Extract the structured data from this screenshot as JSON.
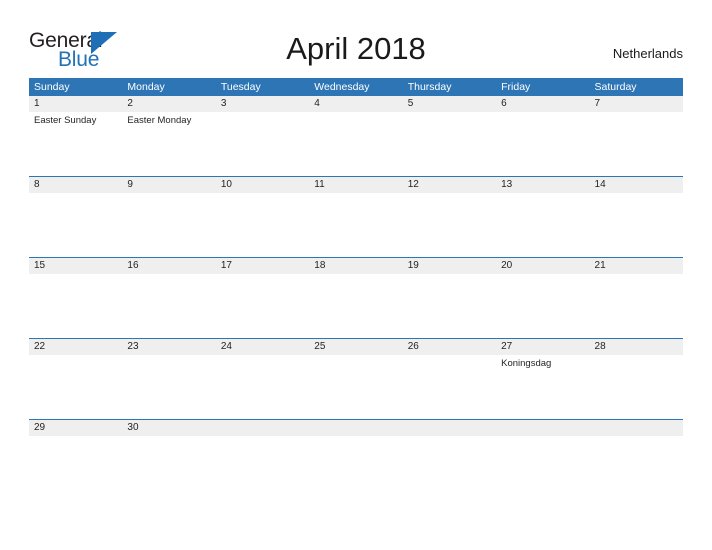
{
  "brand": {
    "line1": "General",
    "line2": "Blue",
    "triangle_color": "#1f6fb6",
    "text_color": "#231f20",
    "accent_color": "#2272b8"
  },
  "header": {
    "title": "April 2018",
    "region": "Netherlands"
  },
  "colors": {
    "header_blue": "#2e75b6",
    "date_band_gray": "#efefef",
    "rule_blue": "#2e75b6",
    "page_background": "#ffffff",
    "text": "#231f20"
  },
  "weekdays": [
    "Sunday",
    "Monday",
    "Tuesday",
    "Wednesday",
    "Thursday",
    "Friday",
    "Saturday"
  ],
  "weeks": [
    {
      "days": [
        {
          "date": "1",
          "event": "Easter Sunday"
        },
        {
          "date": "2",
          "event": "Easter Monday"
        },
        {
          "date": "3",
          "event": ""
        },
        {
          "date": "4",
          "event": ""
        },
        {
          "date": "5",
          "event": ""
        },
        {
          "date": "6",
          "event": ""
        },
        {
          "date": "7",
          "event": ""
        }
      ]
    },
    {
      "days": [
        {
          "date": "8",
          "event": ""
        },
        {
          "date": "9",
          "event": ""
        },
        {
          "date": "10",
          "event": ""
        },
        {
          "date": "11",
          "event": ""
        },
        {
          "date": "12",
          "event": ""
        },
        {
          "date": "13",
          "event": ""
        },
        {
          "date": "14",
          "event": ""
        }
      ]
    },
    {
      "days": [
        {
          "date": "15",
          "event": ""
        },
        {
          "date": "16",
          "event": ""
        },
        {
          "date": "17",
          "event": ""
        },
        {
          "date": "18",
          "event": ""
        },
        {
          "date": "19",
          "event": ""
        },
        {
          "date": "20",
          "event": ""
        },
        {
          "date": "21",
          "event": ""
        }
      ]
    },
    {
      "days": [
        {
          "date": "22",
          "event": ""
        },
        {
          "date": "23",
          "event": ""
        },
        {
          "date": "24",
          "event": ""
        },
        {
          "date": "25",
          "event": ""
        },
        {
          "date": "26",
          "event": ""
        },
        {
          "date": "27",
          "event": "Koningsdag"
        },
        {
          "date": "28",
          "event": ""
        }
      ]
    },
    {
      "days": [
        {
          "date": "29",
          "event": ""
        },
        {
          "date": "30",
          "event": ""
        },
        {
          "date": "",
          "event": ""
        },
        {
          "date": "",
          "event": ""
        },
        {
          "date": "",
          "event": ""
        },
        {
          "date": "",
          "event": ""
        },
        {
          "date": "",
          "event": ""
        }
      ]
    }
  ]
}
